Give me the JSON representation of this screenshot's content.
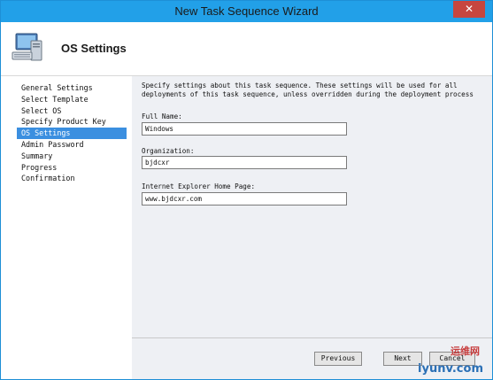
{
  "window": {
    "title": "New Task Sequence Wizard",
    "close_glyph": "✕"
  },
  "header": {
    "title": "OS Settings",
    "icon": "computer-icon"
  },
  "nav": {
    "items": [
      {
        "label": "General Settings"
      },
      {
        "label": "Select Template"
      },
      {
        "label": "Select OS"
      },
      {
        "label": "Specify Product Key"
      },
      {
        "label": "OS Settings"
      },
      {
        "label": "Admin Password"
      },
      {
        "label": "Summary"
      },
      {
        "label": "Progress"
      },
      {
        "label": "Confirmation"
      }
    ],
    "active_index": 4
  },
  "content": {
    "description": "Specify settings about this task sequence.  These settings will be used for all deployments of this task sequence, unless overridden during the deployment process",
    "fields": [
      {
        "label": "Full Name:",
        "value": "Windows"
      },
      {
        "label": "Organization:",
        "value": "bjdcxr"
      },
      {
        "label": "Internet Explorer Home Page:",
        "value": "www.bjdcxr.com"
      }
    ]
  },
  "footer": {
    "previous_label": "Previous",
    "next_label": "Next",
    "cancel_label": "Cancel"
  },
  "watermark": {
    "text": "iyunv.com",
    "text2": "运维网"
  },
  "colors": {
    "titlebar": "#22a0e8",
    "selection": "#3b8fe0",
    "close": "#c7463f"
  }
}
